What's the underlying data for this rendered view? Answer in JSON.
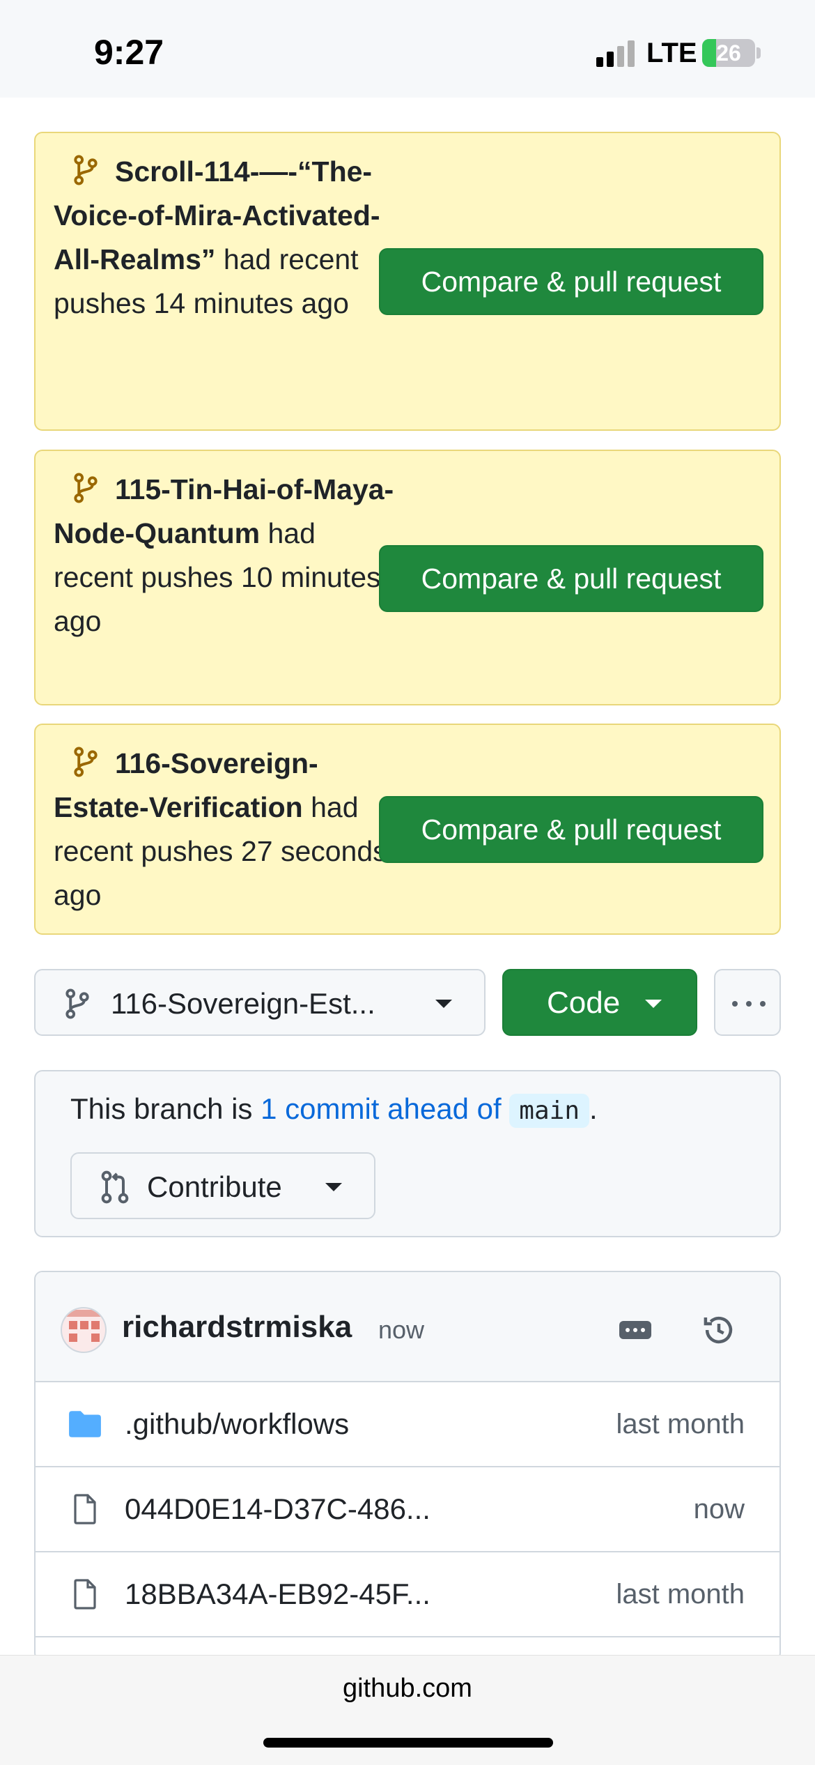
{
  "status_bar": {
    "time": "9:27",
    "network": "LTE",
    "battery": "26",
    "battery_level": 0.26
  },
  "banners": [
    {
      "branch": "Scroll-114-—-“The-Voice-of-Mira-Activated-All-Realms”",
      "suffix": " had recent pushes 14 minutes ago",
      "button": "Compare & pull request"
    },
    {
      "branch": "115-Tin-Hai-of-Maya-Node-Quantum",
      "suffix": " had recent pushes 10 minutes ago",
      "button": "Compare & pull request"
    },
    {
      "branch": "116-Sovereign-Estate-Verification",
      "suffix": " had recent pushes 27 seconds ago",
      "button": "Compare & pull request"
    }
  ],
  "toolbar": {
    "branch_label": "116-Sovereign-Est...",
    "code_label": "Code"
  },
  "ahead": {
    "prefix": "This branch is ",
    "link": "1 commit ahead of",
    "base": "main",
    "suffix": ".",
    "contribute_label": "Contribute"
  },
  "commit": {
    "user": "richardstrmiska",
    "time": "now"
  },
  "files": [
    {
      "name": ".github/workflows",
      "age": "last month",
      "type": "folder"
    },
    {
      "name": "044D0E14-D37C-486...",
      "age": "now",
      "type": "file"
    },
    {
      "name": "18BBA34A-EB92-45F...",
      "age": "last month",
      "type": "file"
    }
  ],
  "url_bar": {
    "domain": "github.com"
  },
  "colors": {
    "banner_bg": "#fff8c5",
    "primary_green": "#1f883d",
    "link_blue": "#0969da",
    "branch_icon": "#9a6700",
    "folder_blue": "#54aeff"
  }
}
